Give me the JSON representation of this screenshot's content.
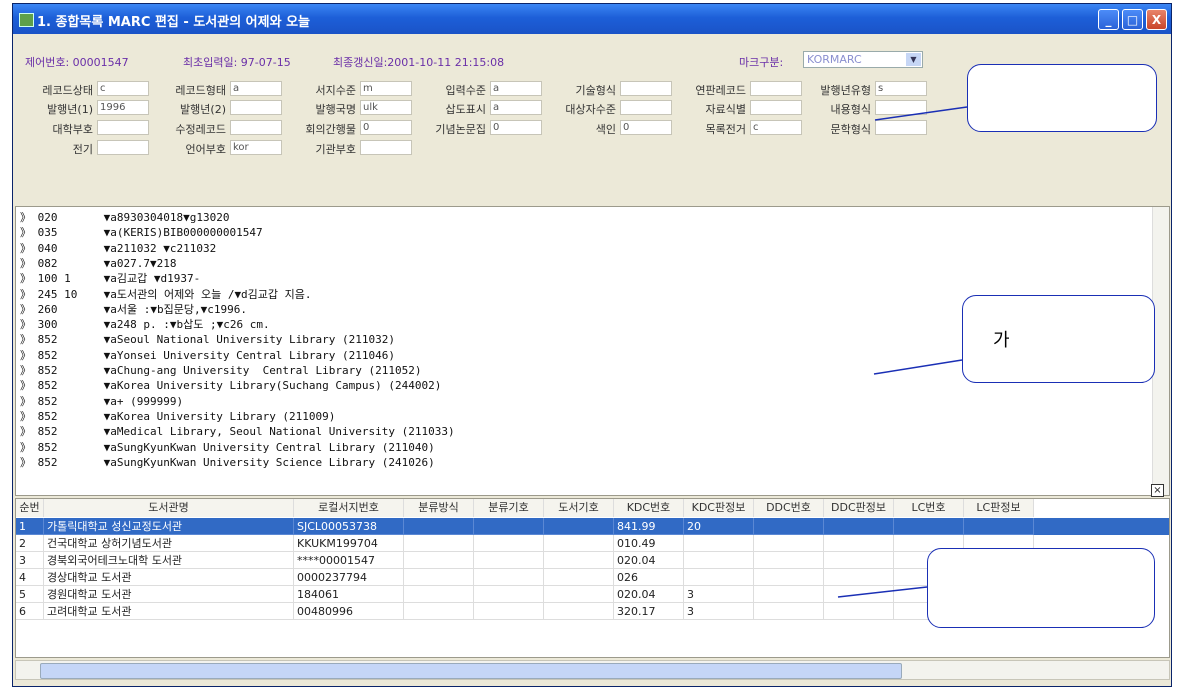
{
  "window": {
    "title": "1. 종합목록 MARC 편집 - 도서관의 어제와 오늘",
    "buttons": {
      "minimize": "_",
      "maximize": "□",
      "close": "X"
    }
  },
  "meta": {
    "control_no": "제어번호: 00001547",
    "first_input": "최초입력일: 97-07-15",
    "last_update": "최종갱신일:2001-10-11 21:15:08",
    "marc_type_label": "마크구분:",
    "marc_type_value": "KORMARC"
  },
  "fixed_fields": [
    [
      {
        "label": "레코드상태",
        "value": "c"
      },
      {
        "label": "레코드형태",
        "value": "a"
      },
      {
        "label": "서지수준",
        "value": "m"
      },
      {
        "label": "입력수준",
        "value": "a"
      },
      {
        "label": "기술형식",
        "value": ""
      },
      {
        "label": "연판레코드",
        "value": ""
      },
      {
        "label": "발행년유형",
        "value": "s"
      }
    ],
    [
      {
        "label": "발행년(1)",
        "value": "1996"
      },
      {
        "label": "발행년(2)",
        "value": ""
      },
      {
        "label": "발행국명",
        "value": "ulk"
      },
      {
        "label": "삽도표시",
        "value": "a"
      },
      {
        "label": "대상자수준",
        "value": ""
      },
      {
        "label": "자료식별",
        "value": ""
      },
      {
        "label": "내용형식",
        "value": ""
      }
    ],
    [
      {
        "label": "대학부호",
        "value": ""
      },
      {
        "label": "수정레코드",
        "value": ""
      },
      {
        "label": "회의간행물",
        "value": "0"
      },
      {
        "label": "기념논문집",
        "value": "0"
      },
      {
        "label": "색인",
        "value": "0"
      },
      {
        "label": "목록전거",
        "value": "c"
      },
      {
        "label": "문학형식",
        "value": ""
      }
    ],
    [
      {
        "label": "전기",
        "value": ""
      },
      {
        "label": "언어부호",
        "value": "kor"
      },
      {
        "label": "기관부호",
        "value": ""
      }
    ]
  ],
  "marc_lines": [
    {
      "tag": "020",
      "data": "▼a8930304018▼g13020"
    },
    {
      "tag": "035",
      "data": "▼a(KERIS)BIB000000001547"
    },
    {
      "tag": "040",
      "data": "▼a211032 ▼c211032"
    },
    {
      "tag": "082",
      "data": "▼a027.7▼218"
    },
    {
      "tag": "100 1",
      "data": "▼a김교갑 ▼d1937-"
    },
    {
      "tag": "245 10",
      "data": "▼a도서관의 어제와 오늘 /▼d김교갑 지음."
    },
    {
      "tag": "260",
      "data": "▼a서울 :▼b집문당,▼c1996."
    },
    {
      "tag": "300",
      "data": "▼a248 p. :▼b삽도 ;▼c26 cm."
    },
    {
      "tag": "852",
      "data": "▼aSeoul National University Library (211032)"
    },
    {
      "tag": "852",
      "data": "▼aYonsei University Central Library (211046)"
    },
    {
      "tag": "852",
      "data": "▼aChung-ang University  Central Library (211052)"
    },
    {
      "tag": "852",
      "data": "▼aKorea University Library(Suchang Campus) (244002)"
    },
    {
      "tag": "852",
      "data": "▼a+ (999999)"
    },
    {
      "tag": "852",
      "data": "▼aKorea University Library (211009)"
    },
    {
      "tag": "852",
      "data": "▼aMedical Library, Seoul National University (211033)"
    },
    {
      "tag": "852",
      "data": "▼aSungKyunKwan University Central Library (211040)"
    },
    {
      "tag": "852",
      "data": "▼aSungKyunKwan University Science Library (241026)"
    }
  ],
  "holdings": {
    "columns": [
      "순번",
      "도서관명",
      "로컬서지번호",
      "분류방식",
      "분류기호",
      "도서기호",
      "KDC번호",
      "KDC판정보",
      "DDC번호",
      "DDC판정보",
      "LC번호",
      "LC판정보"
    ],
    "rows": [
      [
        "1",
        "가톨릭대학교 성신교정도서관",
        "SJCL00053738",
        "",
        "",
        "",
        "841.99",
        "20",
        "",
        "",
        "",
        ""
      ],
      [
        "2",
        "건국대학교 상허기념도서관",
        "KKUKM199704",
        "",
        "",
        "",
        "010.49",
        "",
        "",
        "",
        "",
        ""
      ],
      [
        "3",
        "경북외국어테크노대학 도서관",
        "****00001547",
        "",
        "",
        "",
        "020.04",
        "",
        "",
        "",
        "",
        ""
      ],
      [
        "4",
        "경상대학교 도서관",
        "0000237794",
        "",
        "",
        "",
        "026",
        "",
        "",
        "",
        "",
        ""
      ],
      [
        "5",
        "경원대학교 도서관",
        "184061",
        "",
        "",
        "",
        "020.04",
        "3",
        "",
        "",
        "",
        ""
      ],
      [
        "6",
        "고려대학교 도서관",
        "00480996",
        "",
        "",
        "",
        "320.17",
        "3",
        "",
        "",
        "",
        ""
      ]
    ]
  },
  "annotations": {
    "callout_ga": "가"
  },
  "colors": {
    "title_bar": "#1d5fd8",
    "selected_row": "#316ac5",
    "meta_text": "#6a2fa8",
    "callout_border": "#1a2fb5"
  }
}
